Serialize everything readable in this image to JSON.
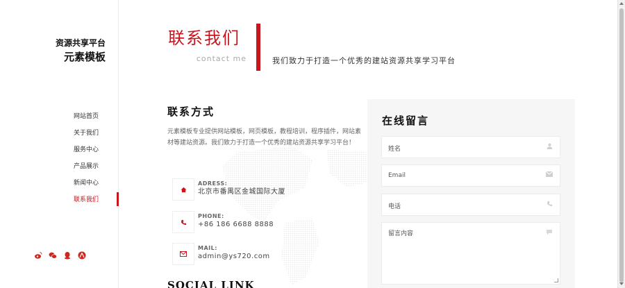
{
  "logo": {
    "line1": "资源共享平台",
    "line2": "元素模板"
  },
  "nav": {
    "items": [
      {
        "label": "网站首页"
      },
      {
        "label": "关于我们"
      },
      {
        "label": "服务中心"
      },
      {
        "label": "产品展示"
      },
      {
        "label": "新闻中心"
      },
      {
        "label": "联系我们",
        "active": true
      }
    ]
  },
  "social_icons": [
    "weibo-icon",
    "wechat-icon",
    "qq-icon",
    "renren-icon"
  ],
  "header": {
    "title_cn": "联系我们",
    "title_en": "contact me",
    "slogan": "我们致力于打造一个优秀的建站资源共享学习平台"
  },
  "contact": {
    "heading": "联系方式",
    "description": "元素模板专业提供网站模板，网页模板，教程培训，程序插件，网站素材等建站资源。我们致力于打造一个优秀的建站资源共享学习平台！",
    "items": [
      {
        "label": "ADRESS:",
        "value": "北京市番禺区金城国际大厦",
        "icon": "home-icon"
      },
      {
        "label": "PHONE:",
        "value": "+86 186 6688 8888",
        "icon": "phone-icon"
      },
      {
        "label": "MAIL:",
        "value": "admin@ys720.com",
        "icon": "mail-icon"
      }
    ],
    "social_heading": "SOCIAL LINK"
  },
  "form": {
    "heading": "在线留言",
    "name_placeholder": "姓名",
    "email_placeholder": "Email",
    "phone_placeholder": "电话",
    "message_placeholder": "留言内容"
  },
  "colors": {
    "accent": "#c9151e",
    "panel_bg": "#f6f6f6"
  }
}
